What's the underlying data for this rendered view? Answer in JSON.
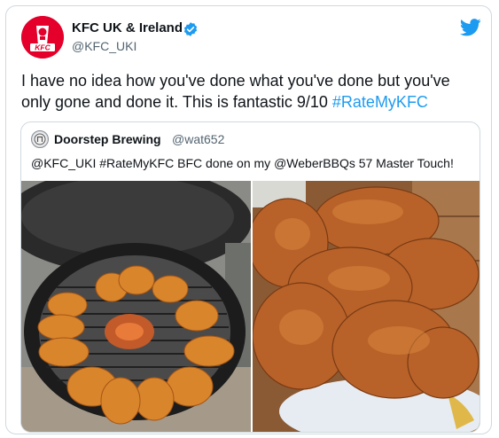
{
  "tweet": {
    "author_name": "KFC UK & Ireland",
    "author_handle": "@KFC_UKI",
    "avatar_logo_text": "KFC",
    "text_main": "I have no idea how you've done what you've done but you've only gone and done it. This is fantastic 9/10 ",
    "hashtag": "#RateMyKFC"
  },
  "quoted_tweet": {
    "author_name": "Doorstep Brewing",
    "author_handle": "@wat652",
    "text": "@KFC_UKI #RateMyKFC BFC done on my @WeberBBQs 57 Master Touch!"
  },
  "icons": {
    "verified": "verified-badge-icon",
    "platform": "twitter-bird-icon"
  },
  "colors": {
    "brand_red": "#e4002b",
    "link_blue": "#1d9bf0",
    "twitter_blue": "#1d9bf0"
  }
}
